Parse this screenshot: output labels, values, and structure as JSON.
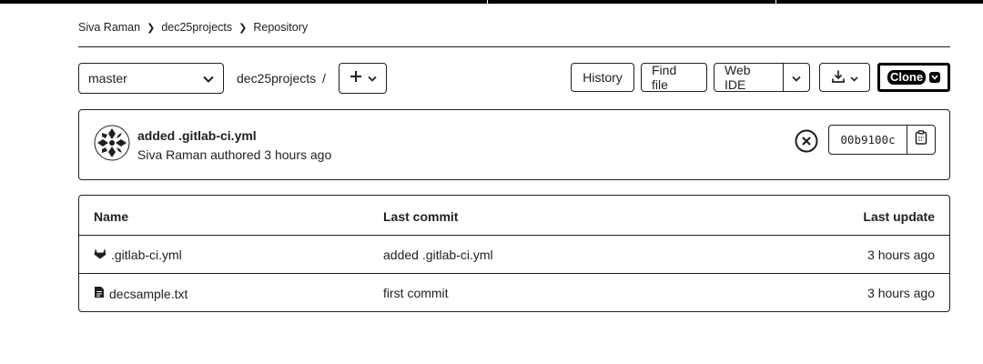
{
  "breadcrumb": {
    "items": [
      "Siva Raman",
      "dec25projects",
      "Repository"
    ]
  },
  "toolbar": {
    "branch": "master",
    "path": "dec25projects",
    "path_separator": "/",
    "add_icon": "plus-icon",
    "history_label": "History",
    "find_file_label": "Find file",
    "web_ide_label": "Web IDE",
    "download_icon": "download-icon",
    "clone_label": "Clone"
  },
  "commit": {
    "title": "added .gitlab-ci.yml",
    "meta": "Siva Raman authored 3 hours ago",
    "status_icon": "pipeline-failed-icon",
    "sha": "00b9100c",
    "copy_icon": "copy-icon"
  },
  "table": {
    "headers": {
      "name": "Name",
      "last_commit": "Last commit",
      "last_update": "Last update"
    },
    "rows": [
      {
        "icon": "gitlab-icon",
        "name": ".gitlab-ci.yml",
        "last_commit": "added .gitlab-ci.yml",
        "last_update": "3 hours ago"
      },
      {
        "icon": "file-text-icon",
        "name": "decsample.txt",
        "last_commit": "first commit",
        "last_update": "3 hours ago"
      }
    ]
  }
}
